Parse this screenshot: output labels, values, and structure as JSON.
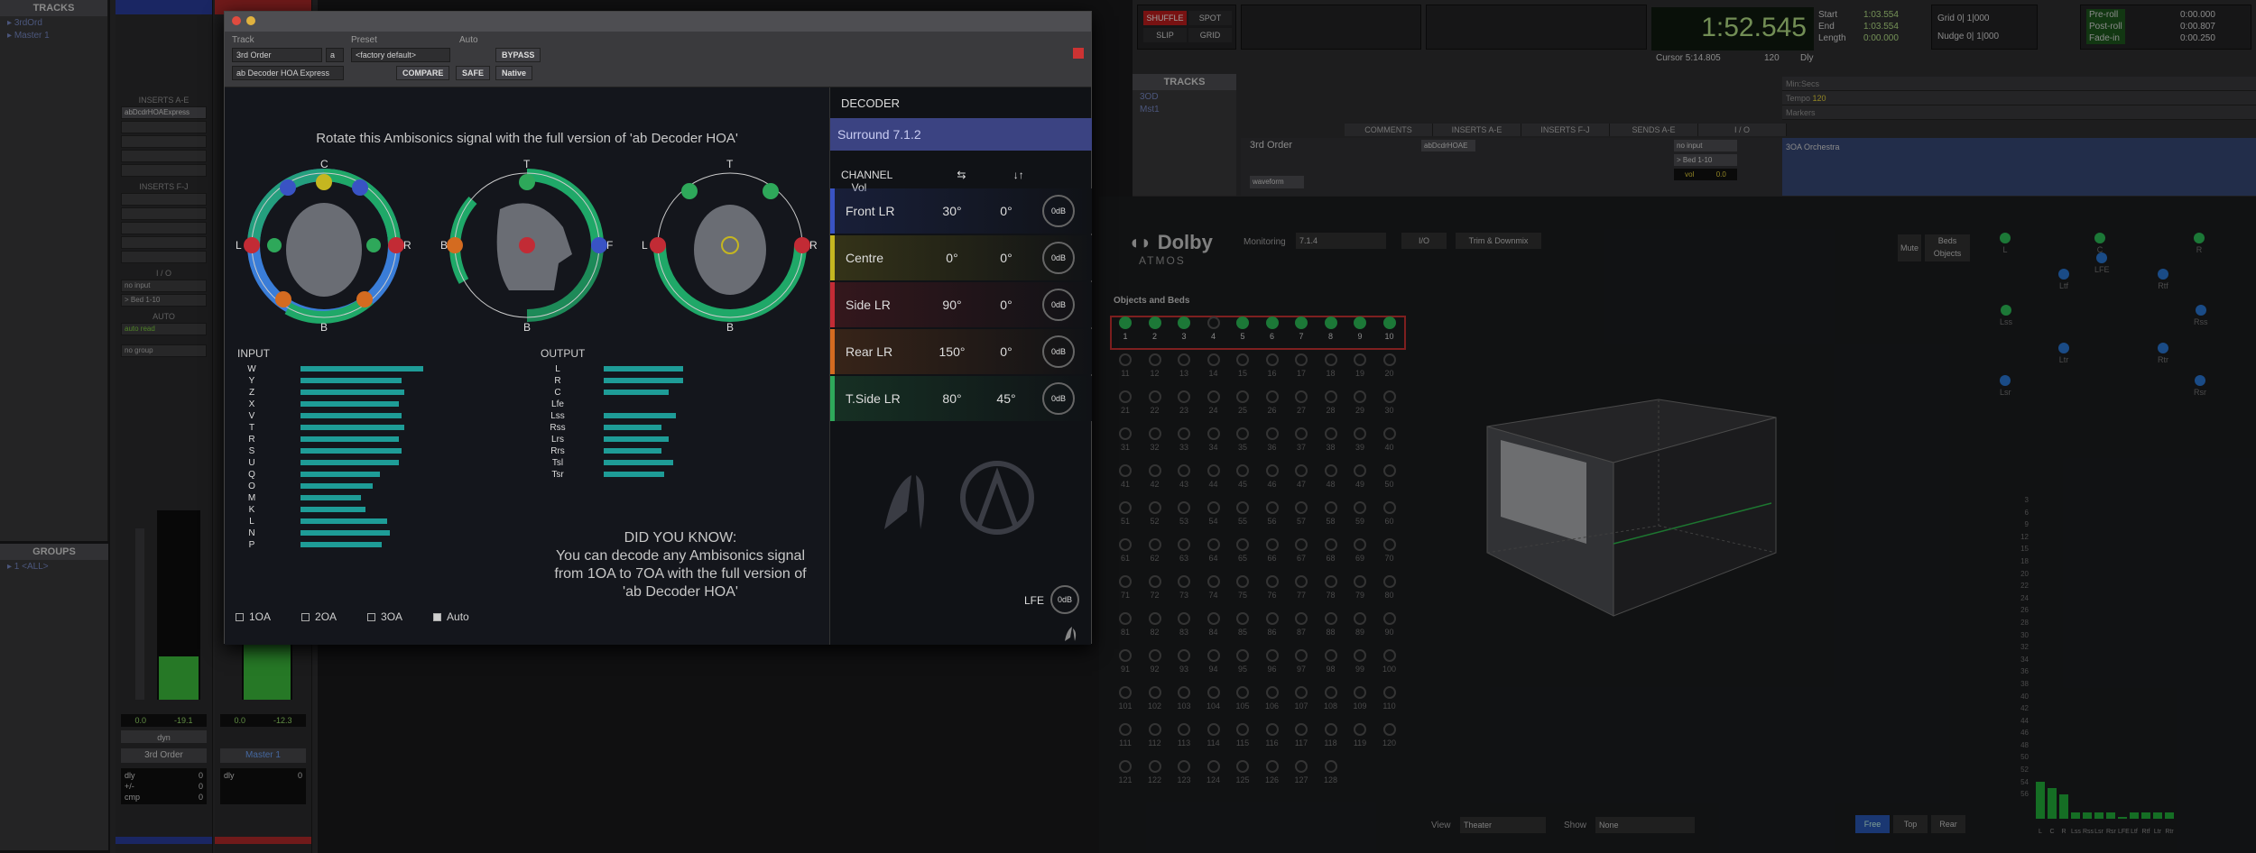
{
  "tracks_pane": {
    "title": "TRACKS",
    "items": [
      "3rdOrd",
      "Master 1"
    ]
  },
  "groups_pane": {
    "title": "GROUPS",
    "items": [
      "<ALL>"
    ]
  },
  "strips": [
    {
      "name": "3rd Order",
      "inserts_ae_label": "INSERTS A-E",
      "insert_1": "abDcdrHOAExpress",
      "inserts_fj_label": "INSERTS F-J",
      "io_label": "I / O",
      "input": "no input",
      "output": "> Bed 1-10",
      "auto_label": "AUTO",
      "auto_mode": "auto read",
      "group": "no group",
      "vol": "0.0",
      "peak": "-19.1",
      "dyn": "dyn",
      "auto_rows": [
        [
          "dly",
          "0"
        ],
        [
          "+/-",
          "0"
        ],
        [
          "cmp",
          "0"
        ]
      ],
      "meter_fill": 0.23
    },
    {
      "name": "Master 1",
      "vol": "0.0",
      "peak": "-12.3",
      "auto_rows": [
        [
          "dly",
          "0"
        ]
      ],
      "meter_fill": 0.36
    }
  ],
  "plugin": {
    "header": {
      "track_label": "Track",
      "preset_label": "Preset",
      "auto_label": "Auto",
      "track_value": "3rd Order",
      "track_suffix": "a",
      "preset_value": "<factory default>",
      "insert_value": "ab Decoder HOA Express",
      "compare": "COMPARE",
      "safe": "SAFE",
      "bypass": "BYPASS",
      "native": "Native"
    },
    "promo_top": "Rotate this Ambisonics signal with the full version of 'ab Decoder HOA'",
    "input_label": "INPUT",
    "output_label": "OUTPUT",
    "input_channels": [
      "W",
      "Y",
      "Z",
      "X",
      "V",
      "T",
      "R",
      "S",
      "U",
      "Q",
      "O",
      "M",
      "K",
      "L",
      "N",
      "P"
    ],
    "input_levels": [
      0.85,
      0.7,
      0.72,
      0.68,
      0.7,
      0.72,
      0.68,
      0.7,
      0.68,
      0.55,
      0.5,
      0.42,
      0.45,
      0.6,
      0.62,
      0.56
    ],
    "output_channels": [
      "L",
      "R",
      "C",
      "Lfe",
      "Lss",
      "Rss",
      "Lrs",
      "Rrs",
      "Tsl",
      "Tsr"
    ],
    "output_levels": [
      0.55,
      0.55,
      0.45,
      0.0,
      0.5,
      0.4,
      0.45,
      0.4,
      0.48,
      0.42
    ],
    "did_you_know": [
      "DID YOU KNOW:",
      "You can decode any Ambisonics signal",
      "from 1OA to 7OA with the full version of",
      "'ab Decoder HOA'"
    ],
    "orders": [
      {
        "label": "1OA",
        "checked": false
      },
      {
        "label": "2OA",
        "checked": false
      },
      {
        "label": "3OA",
        "checked": false
      },
      {
        "label": "Auto",
        "checked": true
      }
    ],
    "head_letters": {
      "L": "L",
      "R": "R",
      "B": "B",
      "F": "F",
      "T": "T",
      "C": "C"
    }
  },
  "decoder": {
    "title": "DECODER",
    "layout": "Surround 7.1.2",
    "col_channel": "CHANNEL",
    "col_az": "⇆",
    "col_el": "↓↑",
    "col_vol": "Vol",
    "channels": [
      {
        "name": "Front LR",
        "az": "30°",
        "el": "0°",
        "vol": "0dB",
        "color": "#3953c4"
      },
      {
        "name": "Centre",
        "az": "0°",
        "el": "0°",
        "vol": "0dB",
        "color": "#c5b620"
      },
      {
        "name": "Side LR",
        "az": "90°",
        "el": "0°",
        "vol": "0dB",
        "color": "#c22b35"
      },
      {
        "name": "Rear LR",
        "az": "150°",
        "el": "0°",
        "vol": "0dB",
        "color": "#d46b20"
      },
      {
        "name": "T.Side LR",
        "az": "80°",
        "el": "45°",
        "vol": "0dB",
        "color": "#2ea85a"
      }
    ],
    "lfe_label": "LFE",
    "lfe_vol": "0dB"
  },
  "edit": {
    "shuffle": "SHUFFLE",
    "spot": "SPOT",
    "slip": "SLIP",
    "grid": "GRID",
    "main_counter": "1:52.545",
    "start_label": "Start",
    "end_label": "End",
    "length_label": "Length",
    "start": "1:03.554",
    "end": "1:03.554",
    "length": "0:00.000",
    "cursor_label": "Cursor",
    "cursor": "5:14.805",
    "tempo": "120",
    "dly": "Dly",
    "grid_label": "Grid",
    "grid_value": "0| 1|000",
    "nudge_label": "Nudge",
    "nudge_value": "0| 1|000",
    "preroll_label": "Pre-roll",
    "postroll_label": "Post-roll",
    "fadein_label": "Fade-in",
    "preroll": "0:00.000",
    "postroll": "0:00.807",
    "fadein": "0:00.250",
    "tracks_title": "TRACKS",
    "track_items": [
      "3OD",
      "Mst1"
    ],
    "ruler_labels": [
      "Min:Secs",
      "Tempo",
      "Markers"
    ],
    "tempo_marker": "120",
    "col_headers": [
      "COMMENTS",
      "INSERTS A-E",
      "INSERTS F-J",
      "SENDS A-E",
      "I / O"
    ],
    "track_name": "3rd Order",
    "track_view": "waveform",
    "track_insert": "abDcdrHOAE",
    "track_input": "no input",
    "track_output": "> Bed 1-10",
    "track_vol_label": "vol",
    "track_vol": "0.0",
    "clip_name": "3OA Orchestra"
  },
  "dolby": {
    "brand": "Dolby",
    "sub": "ATMOS",
    "monitoring_label": "Monitoring",
    "monitoring_value": "7.1.4",
    "io": "I/O",
    "trim": "Trim & Downmix",
    "mute": "Mute",
    "beds": "Beds",
    "objects": "Objects",
    "objects_title": "Objects and Beds",
    "active_beds": [
      1,
      2,
      3,
      5,
      6,
      7,
      8,
      9,
      10
    ],
    "view_label": "View",
    "view_value": "Theater",
    "show_label": "Show",
    "show_value": "None",
    "view_buttons": [
      "Free",
      "Top",
      "Rear"
    ],
    "speakers": [
      "L",
      "C",
      "R",
      "LFE",
      "Ltf",
      "Rtf",
      "Lss",
      "Rss",
      "Ltr",
      "Rtr",
      "Lsr",
      "Rsr"
    ],
    "level_scale": [
      "3",
      "6",
      "9",
      "12",
      "15",
      "18",
      "20",
      "22",
      "24",
      "26",
      "28",
      "30",
      "32",
      "34",
      "36",
      "38",
      "40",
      "42",
      "44",
      "46",
      "48",
      "50",
      "52",
      "54",
      "56"
    ],
    "level_channels": [
      "L",
      "C",
      "R",
      "Lss",
      "Rss",
      "Lsr",
      "Rsr",
      "LFE",
      "Ltf",
      "Rtf",
      "Ltr",
      "Rtr"
    ],
    "levels": [
      0.12,
      0.1,
      0.08,
      0.02,
      0.02,
      0.02,
      0.02,
      0.0,
      0.02,
      0.02,
      0.02,
      0.02
    ]
  }
}
